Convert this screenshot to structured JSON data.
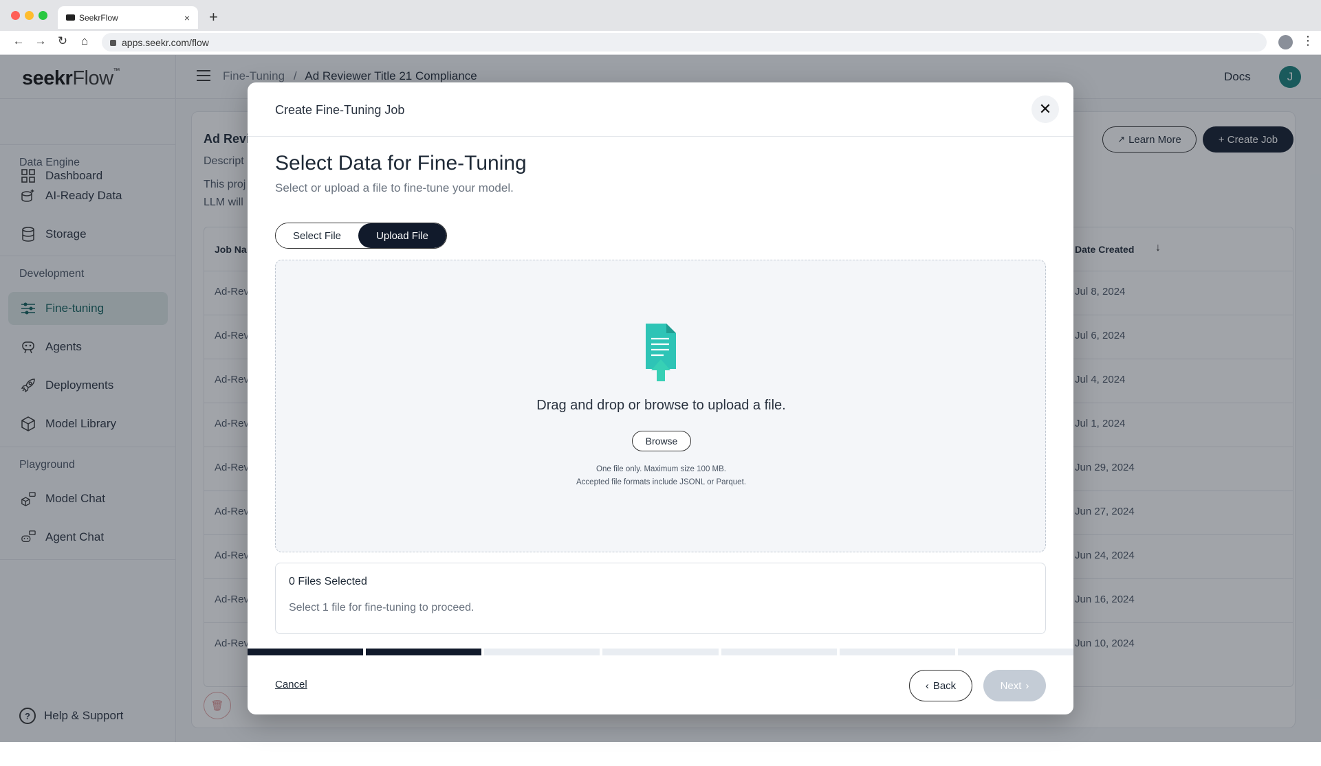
{
  "browser": {
    "tab_title": "SeekrFlow",
    "url": "apps.seekr.com/flow",
    "new_tab": "+",
    "tab_close": "×"
  },
  "brand": {
    "seekr": "seekr",
    "flow": "Flow",
    "tm": "™"
  },
  "sidebar": {
    "dashboard": "Dashboard",
    "section_data_engine": "Data Engine",
    "ai_ready_data": "AI-Ready Data",
    "storage": "Storage",
    "section_development": "Development",
    "fine_tuning": "Fine-tuning",
    "agents": "Agents",
    "deployments": "Deployments",
    "model_library": "Model Library",
    "section_playground": "Playground",
    "model_chat": "Model Chat",
    "agent_chat": "Agent Chat",
    "help": "Help & Support"
  },
  "topbar": {
    "crumb_parent": "Fine-Tuning",
    "crumb_sep": "/",
    "crumb_current": "Ad Reviewer Title 21 Compliance",
    "docs": "Docs",
    "avatar": "J"
  },
  "project": {
    "title": "Ad Revi",
    "desc_label": "Descript",
    "desc_line1": "This proj",
    "desc_line2": "LLM will",
    "learn_more": "Learn More",
    "create_job": "+ Create Job"
  },
  "table": {
    "col_job": "Job Na",
    "col_date": "Date Created",
    "rows": [
      {
        "name": "Ad-Rev",
        "date": "Jul 8, 2024"
      },
      {
        "name": "Ad-Rev",
        "date": "Jul 6, 2024"
      },
      {
        "name": "Ad-Rev",
        "date": "Jul 4, 2024"
      },
      {
        "name": "Ad-Rev",
        "date": "Jul 1, 2024"
      },
      {
        "name": "Ad-Rev",
        "date": "Jun 29, 2024"
      },
      {
        "name": "Ad-Rev",
        "date": "Jun 27, 2024"
      },
      {
        "name": "Ad-Rev",
        "date": "Jun 24, 2024"
      },
      {
        "name": "Ad-Rev",
        "date": "Jun 16, 2024"
      },
      {
        "name": "Ad-Rev",
        "date": "Jun 10, 2024"
      }
    ]
  },
  "modal": {
    "title": "Create Fine-Tuning Job",
    "heading": "Select Data for Fine-Tuning",
    "subheading": "Select or upload a file to fine-tune your model.",
    "tab_select": "Select File",
    "tab_upload": "Upload File",
    "drop_text": "Drag and drop or browse to upload a file.",
    "browse": "Browse",
    "note1": "One file only. Maximum size 100 MB.",
    "note2": "Accepted file formats include JSONL or Parquet.",
    "files_selected": "0 Files Selected",
    "files_msg": "Select 1 file for fine-tuning to proceed.",
    "cancel": "Cancel",
    "back": "Back",
    "next": "Next",
    "steps_total": 7,
    "steps_done": 2
  },
  "colors": {
    "accent": "#17807a",
    "dark": "#111a2b",
    "upload_icon": "#2ec4b6"
  }
}
